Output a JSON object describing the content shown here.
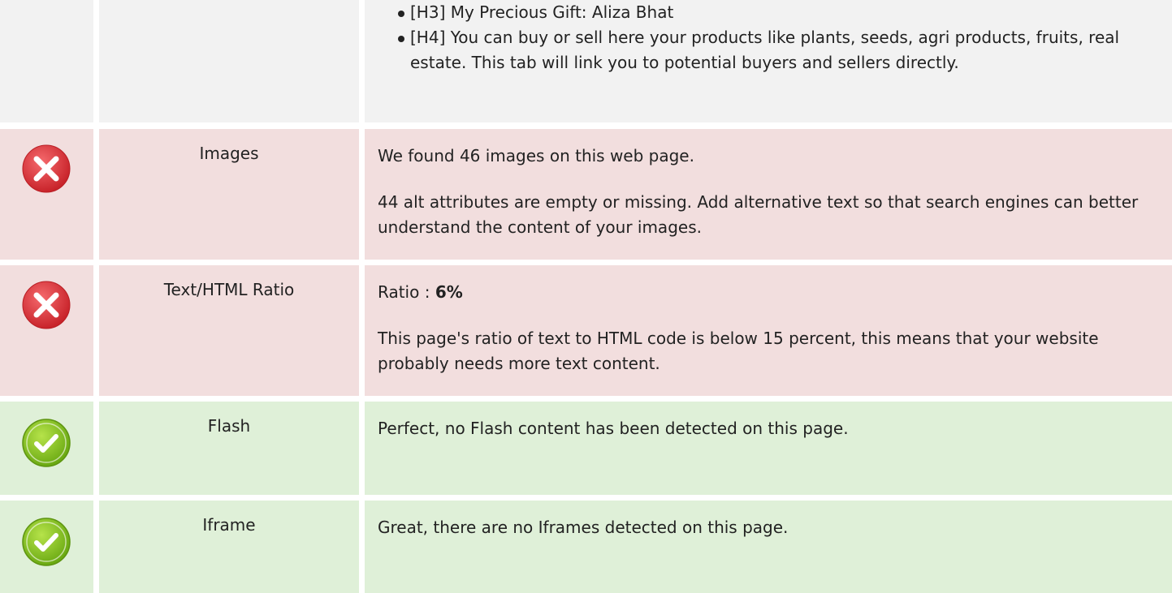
{
  "rows": [
    {
      "type": "neutral",
      "headings": [
        "[H3] My Precious Gift: Aliza Bhat",
        "[H4] You can buy or sell here your products like plants, seeds, agri products, fruits, real estate. This tab will link you to potential buyers and sellers directly."
      ]
    },
    {
      "type": "error",
      "label": "Images",
      "icon": "error-x-icon",
      "p1": "We found 46 images on this web page.",
      "p2": "44 alt attributes are empty or missing. Add alternative text so that search engines can better understand the content of your images."
    },
    {
      "type": "error",
      "label": "Text/HTML Ratio",
      "icon": "error-x-icon",
      "ratio_prefix": "Ratio : ",
      "ratio_value": "6%",
      "p2": "This page's ratio of text to HTML code is below 15 percent, this means that your website probably needs more text content."
    },
    {
      "type": "ok",
      "label": "Flash",
      "icon": "check-icon",
      "p1": "Perfect, no Flash content has been detected on this page."
    },
    {
      "type": "ok",
      "label": "Iframe",
      "icon": "check-icon",
      "p1": "Great, there are no Iframes detected on this page."
    }
  ],
  "colors": {
    "neutral_bg": "#f2f2f2",
    "error_bg": "#f2dede",
    "ok_bg": "#dff0d8",
    "error_icon": "#e0393e",
    "ok_icon": "#8bc820"
  }
}
